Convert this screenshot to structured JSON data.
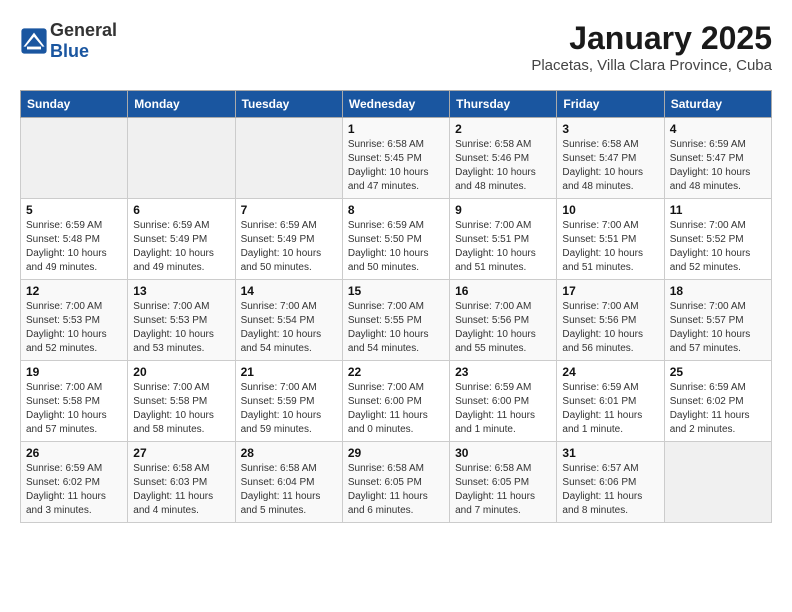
{
  "header": {
    "logo_general": "General",
    "logo_blue": "Blue",
    "title": "January 2025",
    "subtitle": "Placetas, Villa Clara Province, Cuba"
  },
  "days_of_week": [
    "Sunday",
    "Monday",
    "Tuesday",
    "Wednesday",
    "Thursday",
    "Friday",
    "Saturday"
  ],
  "weeks": [
    [
      {
        "day": "",
        "detail": ""
      },
      {
        "day": "",
        "detail": ""
      },
      {
        "day": "",
        "detail": ""
      },
      {
        "day": "1",
        "detail": "Sunrise: 6:58 AM\nSunset: 5:45 PM\nDaylight: 10 hours\nand 47 minutes."
      },
      {
        "day": "2",
        "detail": "Sunrise: 6:58 AM\nSunset: 5:46 PM\nDaylight: 10 hours\nand 48 minutes."
      },
      {
        "day": "3",
        "detail": "Sunrise: 6:58 AM\nSunset: 5:47 PM\nDaylight: 10 hours\nand 48 minutes."
      },
      {
        "day": "4",
        "detail": "Sunrise: 6:59 AM\nSunset: 5:47 PM\nDaylight: 10 hours\nand 48 minutes."
      }
    ],
    [
      {
        "day": "5",
        "detail": "Sunrise: 6:59 AM\nSunset: 5:48 PM\nDaylight: 10 hours\nand 49 minutes."
      },
      {
        "day": "6",
        "detail": "Sunrise: 6:59 AM\nSunset: 5:49 PM\nDaylight: 10 hours\nand 49 minutes."
      },
      {
        "day": "7",
        "detail": "Sunrise: 6:59 AM\nSunset: 5:49 PM\nDaylight: 10 hours\nand 50 minutes."
      },
      {
        "day": "8",
        "detail": "Sunrise: 6:59 AM\nSunset: 5:50 PM\nDaylight: 10 hours\nand 50 minutes."
      },
      {
        "day": "9",
        "detail": "Sunrise: 7:00 AM\nSunset: 5:51 PM\nDaylight: 10 hours\nand 51 minutes."
      },
      {
        "day": "10",
        "detail": "Sunrise: 7:00 AM\nSunset: 5:51 PM\nDaylight: 10 hours\nand 51 minutes."
      },
      {
        "day": "11",
        "detail": "Sunrise: 7:00 AM\nSunset: 5:52 PM\nDaylight: 10 hours\nand 52 minutes."
      }
    ],
    [
      {
        "day": "12",
        "detail": "Sunrise: 7:00 AM\nSunset: 5:53 PM\nDaylight: 10 hours\nand 52 minutes."
      },
      {
        "day": "13",
        "detail": "Sunrise: 7:00 AM\nSunset: 5:53 PM\nDaylight: 10 hours\nand 53 minutes."
      },
      {
        "day": "14",
        "detail": "Sunrise: 7:00 AM\nSunset: 5:54 PM\nDaylight: 10 hours\nand 54 minutes."
      },
      {
        "day": "15",
        "detail": "Sunrise: 7:00 AM\nSunset: 5:55 PM\nDaylight: 10 hours\nand 54 minutes."
      },
      {
        "day": "16",
        "detail": "Sunrise: 7:00 AM\nSunset: 5:56 PM\nDaylight: 10 hours\nand 55 minutes."
      },
      {
        "day": "17",
        "detail": "Sunrise: 7:00 AM\nSunset: 5:56 PM\nDaylight: 10 hours\nand 56 minutes."
      },
      {
        "day": "18",
        "detail": "Sunrise: 7:00 AM\nSunset: 5:57 PM\nDaylight: 10 hours\nand 57 minutes."
      }
    ],
    [
      {
        "day": "19",
        "detail": "Sunrise: 7:00 AM\nSunset: 5:58 PM\nDaylight: 10 hours\nand 57 minutes."
      },
      {
        "day": "20",
        "detail": "Sunrise: 7:00 AM\nSunset: 5:58 PM\nDaylight: 10 hours\nand 58 minutes."
      },
      {
        "day": "21",
        "detail": "Sunrise: 7:00 AM\nSunset: 5:59 PM\nDaylight: 10 hours\nand 59 minutes."
      },
      {
        "day": "22",
        "detail": "Sunrise: 7:00 AM\nSunset: 6:00 PM\nDaylight: 11 hours\nand 0 minutes."
      },
      {
        "day": "23",
        "detail": "Sunrise: 6:59 AM\nSunset: 6:00 PM\nDaylight: 11 hours\nand 1 minute."
      },
      {
        "day": "24",
        "detail": "Sunrise: 6:59 AM\nSunset: 6:01 PM\nDaylight: 11 hours\nand 1 minute."
      },
      {
        "day": "25",
        "detail": "Sunrise: 6:59 AM\nSunset: 6:02 PM\nDaylight: 11 hours\nand 2 minutes."
      }
    ],
    [
      {
        "day": "26",
        "detail": "Sunrise: 6:59 AM\nSunset: 6:02 PM\nDaylight: 11 hours\nand 3 minutes."
      },
      {
        "day": "27",
        "detail": "Sunrise: 6:58 AM\nSunset: 6:03 PM\nDaylight: 11 hours\nand 4 minutes."
      },
      {
        "day": "28",
        "detail": "Sunrise: 6:58 AM\nSunset: 6:04 PM\nDaylight: 11 hours\nand 5 minutes."
      },
      {
        "day": "29",
        "detail": "Sunrise: 6:58 AM\nSunset: 6:05 PM\nDaylight: 11 hours\nand 6 minutes."
      },
      {
        "day": "30",
        "detail": "Sunrise: 6:58 AM\nSunset: 6:05 PM\nDaylight: 11 hours\nand 7 minutes."
      },
      {
        "day": "31",
        "detail": "Sunrise: 6:57 AM\nSunset: 6:06 PM\nDaylight: 11 hours\nand 8 minutes."
      },
      {
        "day": "",
        "detail": ""
      }
    ]
  ]
}
